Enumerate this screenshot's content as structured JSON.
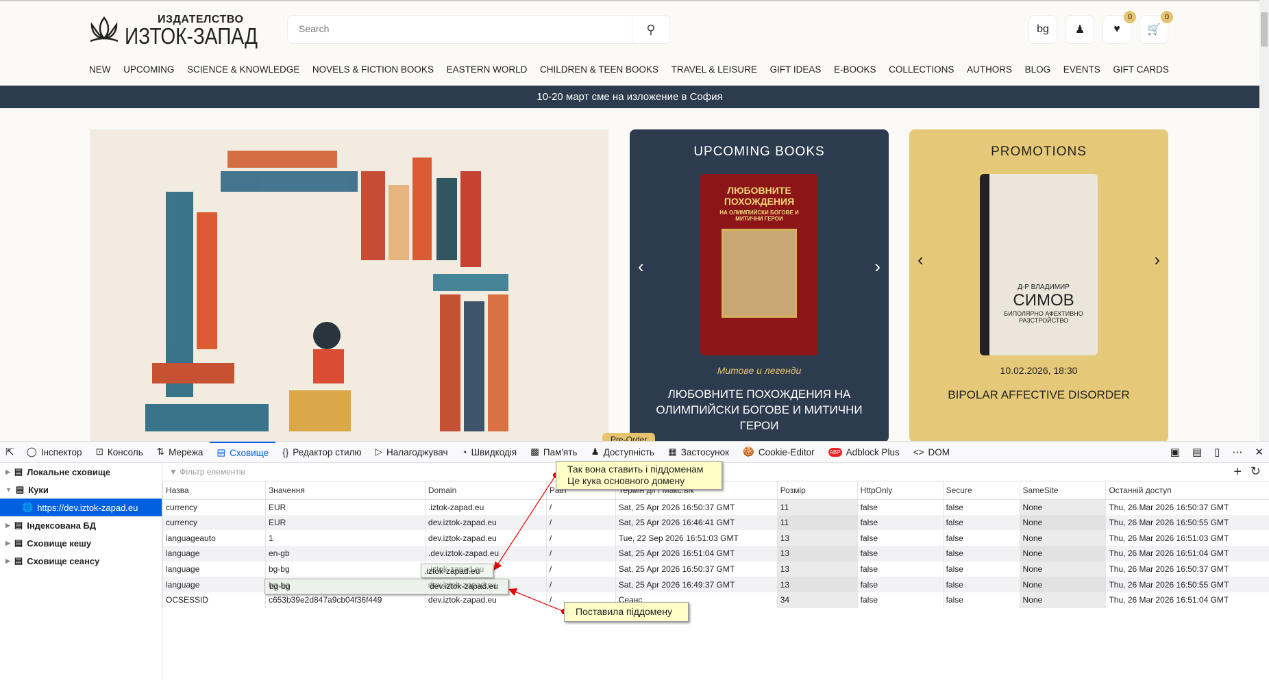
{
  "site": {
    "logo_small": "ИЗДАТЕЛСТВО",
    "logo_big": "ИЗТОК-ЗАПАД",
    "search_placeholder": "Search",
    "lang": "bg",
    "wishlist_count": "0",
    "cart_count": "0",
    "nav": [
      "NEW",
      "UPCOMING",
      "SCIENCE & KNOWLEDGE",
      "NOVELS & FICTION BOOKS",
      "EASTERN WORLD",
      "CHILDREN & TEEN BOOKS",
      "TRAVEL & LEISURE",
      "GIFT IDEAS",
      "E-BOOKS",
      "COLLECTIONS",
      "AUTHORS",
      "BLOG",
      "EVENTS",
      "GIFT CARDS"
    ],
    "banner": "10-20 март сме на изложение в София",
    "upcoming": {
      "title": "UPCOMING BOOKS",
      "cover_title": "ЛЮБОВНИТЕ ПОХОЖДЕНИЯ",
      "cover_sub": "НА ОЛИМПИЙСКИ БОГОВЕ И МИТИЧНИ ГЕРОИ",
      "series": "Митове и легенди",
      "book": "ЛЮБОВНИТЕ ПОХОЖДЕНИЯ НА ОЛИМПИЙСКИ БОГОВЕ И МИТИЧНИ ГЕРОИ",
      "badge": "Pre-Order"
    },
    "promotions": {
      "title": "PROMOTIONS",
      "cover_author": "Д-Р ВЛАДИМИР",
      "cover_name": "СИМОВ",
      "cover_title": "БИПОЛЯРНО АФЕКТИВНО РАЗСТРОЙСТВО",
      "date": "10.02.2026, 18:30",
      "book": "BIPOLAR AFFECTIVE DISORDER"
    }
  },
  "devtools": {
    "tabs": [
      "Інспектор",
      "Консоль",
      "Мережа",
      "Сховище",
      "Редактор стилю",
      "Налагоджувач",
      "Швидкодія",
      "Пам'ять",
      "Доступність",
      "Застосунок",
      "Cookie-Editor",
      "Adblock Plus",
      "DOM"
    ],
    "sidebar": [
      "Локальне сховище",
      "Куки",
      "https://dev.iztok-zapad.eu",
      "Індексована БД",
      "Сховище кешу",
      "Сховище сеансу"
    ],
    "filter_placeholder": "Фільтр елементів",
    "columns": [
      "Назва",
      "Значення",
      "Domain",
      "Path",
      "Термін дії / Макс.вік",
      "Розмір",
      "HttpOnly",
      "Secure",
      "SameSite",
      "Останній доступ"
    ],
    "rows": [
      [
        "currency",
        "EUR",
        ".iztok-zapad.eu",
        "/",
        "Sat, 25 Apr 2026 16:50:37 GMT",
        "11",
        "false",
        "false",
        "None",
        "Thu, 26 Mar 2026 16:50:37 GMT"
      ],
      [
        "currency",
        "EUR",
        "dev.iztok-zapad.eu",
        "/",
        "Sat, 25 Apr 2026 16:46:41 GMT",
        "11",
        "false",
        "false",
        "None",
        "Thu, 26 Mar 2026 16:50:55 GMT"
      ],
      [
        "languageauto",
        "1",
        "dev.iztok-zapad.eu",
        "/",
        "Tue, 22 Sep 2026 16:51:03 GMT",
        "13",
        "false",
        "false",
        "None",
        "Thu, 26 Mar 2026 16:51:03 GMT"
      ],
      [
        "language",
        "en-gb",
        ".dev.iztok-zapad.eu",
        "/",
        "Sat, 25 Apr 2026 16:51:04 GMT",
        "13",
        "false",
        "false",
        "None",
        "Thu, 26 Mar 2026 16:51:04 GMT"
      ],
      [
        "language",
        "bg-bg",
        ".iztok-zapad.eu",
        "/",
        "Sat, 25 Apr 2026 16:50:37 GMT",
        "13",
        "false",
        "false",
        "None",
        "Thu, 26 Mar 2026 16:50:37 GMT"
      ],
      [
        "language",
        "bg-bg",
        "dev.iztok-zapad.eu",
        "/",
        "Sat, 25 Apr 2026 16:49:37 GMT",
        "13",
        "false",
        "false",
        "None",
        "Thu, 26 Mar 2026 16:50:55 GMT"
      ],
      [
        "OCSESSID",
        "c653b39e2d847a9cb04f36f449",
        "dev.iztok-zapad.eu",
        "/",
        "Сеанс",
        "34",
        "false",
        "false",
        "None",
        "Thu, 26 Mar 2026 16:51:04 GMT"
      ]
    ]
  },
  "annotations": {
    "callout1_line1": "Так вона ставить і піддоменам",
    "callout1_line2": "Це кука основного домену",
    "callout2": "Поставила піддомену",
    "highlight1": ".iztok-zapad.eu",
    "highlight2_value": "bg-bg",
    "highlight2_domain": "dev.iztok-zapad.eu"
  }
}
